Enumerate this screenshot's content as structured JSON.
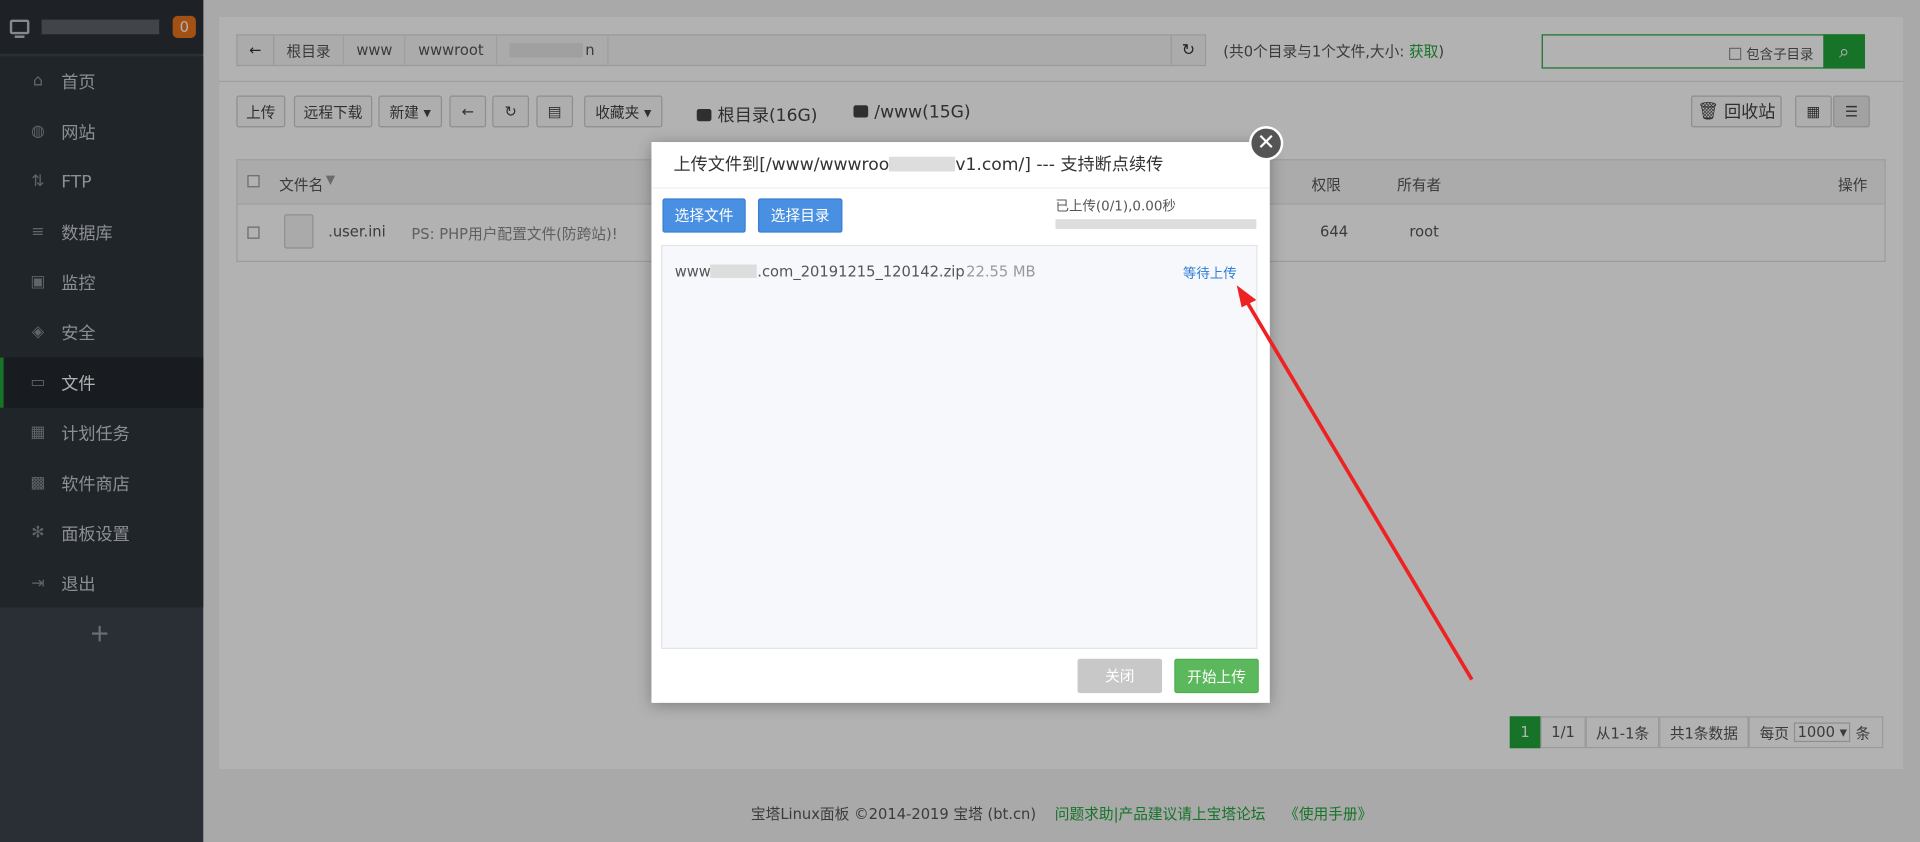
{
  "sidebar": {
    "badge": "0",
    "items": [
      {
        "label": "首页",
        "icon": "home-icon"
      },
      {
        "label": "网站",
        "icon": "globe-icon"
      },
      {
        "label": "FTP",
        "icon": "ftp-icon"
      },
      {
        "label": "数据库",
        "icon": "database-icon"
      },
      {
        "label": "监控",
        "icon": "monitor-icon"
      },
      {
        "label": "安全",
        "icon": "shield-icon"
      },
      {
        "label": "文件",
        "icon": "folder-icon"
      },
      {
        "label": "计划任务",
        "icon": "calendar-icon"
      },
      {
        "label": "软件商店",
        "icon": "apps-icon"
      },
      {
        "label": "面板设置",
        "icon": "gear-icon"
      },
      {
        "label": "退出",
        "icon": "logout-icon"
      }
    ],
    "active_index": 6,
    "add": "+"
  },
  "breadcrumb": [
    "根目录",
    "www",
    "wwwroot",
    "n"
  ],
  "summary": {
    "text": "(共0个目录与1个文件,大小:",
    "link": "获取",
    "end": ")"
  },
  "search": {
    "include_sub": "包含子目录"
  },
  "toolbar": {
    "upload": "上传",
    "remote_download": "远程下载",
    "new": "新建 ▾",
    "favorites": "收藏夹 ▾",
    "disk_root": "根目录(16G)",
    "disk_www": "/www(15G)",
    "recycle": "回收站"
  },
  "table": {
    "headers": {
      "name": "文件名",
      "perm": "权限",
      "owner": "所有者",
      "ops": "操作"
    },
    "rows": [
      {
        "name": ".user.ini",
        "note": "PS: PHP用户配置文件(防跨站)!",
        "perm": "644",
        "owner": "root"
      }
    ]
  },
  "pager": {
    "page": "1",
    "pages": "1/1",
    "range": "从1-1条",
    "total": "共1条数据",
    "per_label": "每页",
    "per_value": "1000 ▾",
    "unit": "条"
  },
  "footer": {
    "copyright": "宝塔Linux面板 ©2014-2019 宝塔 (bt.cn)",
    "forum": "问题求助|产品建议请上宝塔论坛",
    "manual": "《使用手册》"
  },
  "dialog": {
    "title_a": "上传文件到[/www/wwwroo",
    "title_b": "v1.com/] --- 支持断点续传",
    "select_file": "选择文件",
    "select_dir": "选择目录",
    "progress_text": "已上传(0/1),0.00秒",
    "progress": 0,
    "file_a": "www",
    "file_b": ".com_20191215_120142.zip",
    "file_size": "22.55 MB",
    "file_status": "等待上传",
    "close_btn": "关闭",
    "start_btn": "开始上传",
    "close_icon": "✕"
  },
  "colors": {
    "accent": "#20a53a",
    "blue": "#4a90e2",
    "annotation": "#ee2222"
  }
}
